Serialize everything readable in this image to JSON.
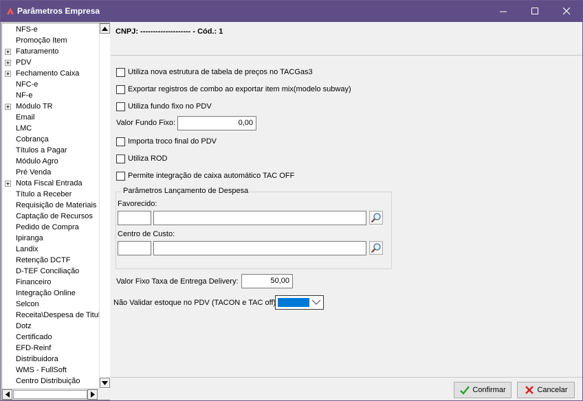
{
  "window": {
    "title": "Parâmetros Empresa",
    "controls": [
      "minimize-icon",
      "maximize-icon",
      "close-icon"
    ]
  },
  "sidebar": {
    "items": [
      {
        "label": "NFS-e",
        "expandable": false
      },
      {
        "label": "Promoção Item",
        "expandable": false
      },
      {
        "label": "Faturamento",
        "expandable": true
      },
      {
        "label": "PDV",
        "expandable": true
      },
      {
        "label": "Fechamento Caixa",
        "expandable": true
      },
      {
        "label": "NFC-e",
        "expandable": false
      },
      {
        "label": "NF-e",
        "expandable": false
      },
      {
        "label": "Módulo TR",
        "expandable": true
      },
      {
        "label": "Email",
        "expandable": false
      },
      {
        "label": "LMC",
        "expandable": false
      },
      {
        "label": "Cobrança",
        "expandable": false
      },
      {
        "label": "Títulos a Pagar",
        "expandable": false
      },
      {
        "label": "Módulo Agro",
        "expandable": false
      },
      {
        "label": "Pré Venda",
        "expandable": false
      },
      {
        "label": "Nota Fiscal Entrada",
        "expandable": true
      },
      {
        "label": "Título a Receber",
        "expandable": false
      },
      {
        "label": "Requisição de Materiais",
        "expandable": false
      },
      {
        "label": "Captação de Recursos",
        "expandable": false
      },
      {
        "label": "Pedido de Compra",
        "expandable": false
      },
      {
        "label": "Ipiranga",
        "expandable": false
      },
      {
        "label": "Landix",
        "expandable": false
      },
      {
        "label": "Retenção DCTF",
        "expandable": false
      },
      {
        "label": "D-TEF Conciliação",
        "expandable": false
      },
      {
        "label": "Financeiro",
        "expandable": false
      },
      {
        "label": "Integração Online",
        "expandable": false
      },
      {
        "label": "Selcon",
        "expandable": false
      },
      {
        "label": "Receita\\Despesa de Titul",
        "expandable": false
      },
      {
        "label": "Dotz",
        "expandable": false
      },
      {
        "label": "Certificado",
        "expandable": false
      },
      {
        "label": "EFD-Reinf",
        "expandable": false
      },
      {
        "label": "Distribuidora",
        "expandable": false
      },
      {
        "label": "WMS - FullSoft",
        "expandable": false
      },
      {
        "label": "Centro Distribuição",
        "expandable": false
      }
    ]
  },
  "header": {
    "cnpj_line": "CNPJ: -------------------- - Cód.: 1"
  },
  "form": {
    "checkboxes": [
      {
        "label": "Utiliza nova estrutura de tabela de preços no TACGas3",
        "checked": false
      },
      {
        "label": "Exportar registros de combo ao exportar item mix(modelo subway)",
        "checked": false
      },
      {
        "label": "Utiliza fundo fixo no PDV",
        "checked": false
      }
    ],
    "valor_fundo_fixo_label": "Valor Fundo Fixo:",
    "valor_fundo_fixo_value": "0,00",
    "checkboxes2": [
      {
        "label": "Importa troco final do PDV",
        "checked": false
      },
      {
        "label": "Utiliza ROD",
        "checked": false
      },
      {
        "label": "Permite integração de caixa automático TAC OFF",
        "checked": false
      }
    ],
    "group": {
      "legend": "Parâmetros Lançamento de Despesa",
      "favorecido_label": "Favorecido:",
      "favorecido_code": "",
      "favorecido_name": "",
      "centro_custo_label": "Centro de Custo:",
      "centro_custo_code": "",
      "centro_custo_name": ""
    },
    "delivery_label": "Valor Fixo Taxa de Entrega Delivery:",
    "delivery_value": "50,00",
    "estoque_label": "Não Validar estoque no PDV (TACON e TAC off):",
    "estoque_selected": ""
  },
  "footer": {
    "confirm_label": "Confirmar",
    "cancel_label": "Cancelar"
  },
  "colors": {
    "titlebar": "#5e4d86",
    "select_highlight": "#0078d7",
    "confirm_icon": "#2e9e2e",
    "cancel_icon": "#d62020"
  }
}
